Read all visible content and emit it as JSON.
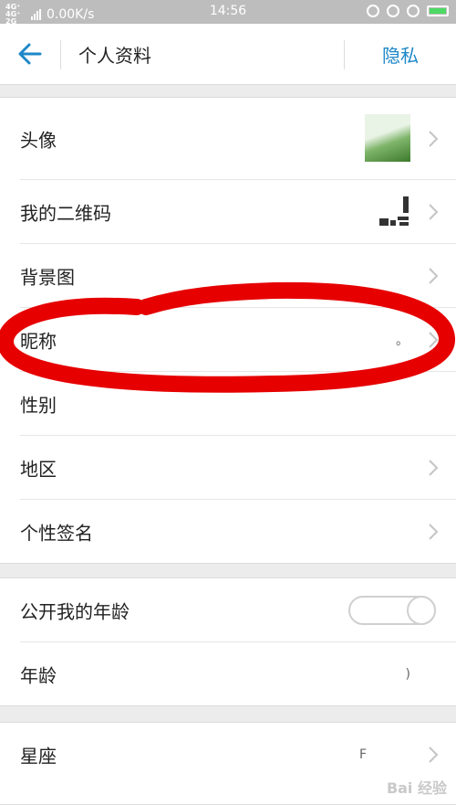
{
  "status_bar": {
    "network": "4G⁺ 4G⁺\n2G",
    "speed": "0.00K/s",
    "time": "14:56"
  },
  "header": {
    "title": "个人资料",
    "privacy_label": "隐私"
  },
  "groups": [
    {
      "items": [
        {
          "label": "头像"
        },
        {
          "label": "我的二维码"
        },
        {
          "label": "背景图"
        },
        {
          "label": "昵称",
          "value": "。"
        },
        {
          "label": "性别"
        },
        {
          "label": "地区"
        },
        {
          "label": "个性签名"
        }
      ]
    },
    {
      "items": [
        {
          "label": "公开我的年龄"
        },
        {
          "label": "年龄",
          "value": ")"
        }
      ]
    },
    {
      "items": [
        {
          "label": "星座",
          "value": "F"
        }
      ]
    }
  ],
  "colors": {
    "accent": "#1e88c8",
    "annotation": "#e60000"
  },
  "watermark": "Bai 经验"
}
